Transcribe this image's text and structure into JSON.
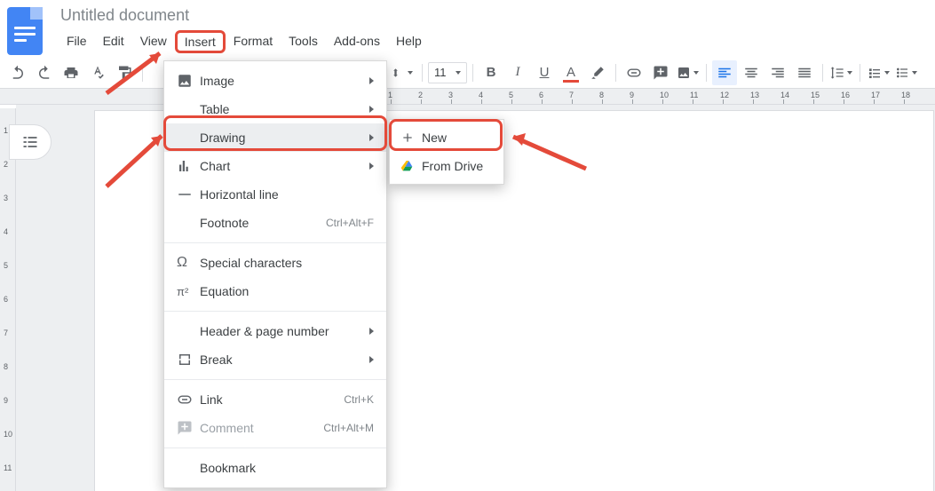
{
  "doc_title": "Untitled document",
  "menus": {
    "file": "File",
    "edit": "Edit",
    "view": "View",
    "insert": "Insert",
    "format": "Format",
    "tools": "Tools",
    "addons": "Add-ons",
    "help": "Help"
  },
  "toolbar": {
    "font_size": "11"
  },
  "ruler": {
    "ticks": [
      "1",
      "2",
      "3",
      "4",
      "5",
      "6",
      "7",
      "8",
      "9",
      "10",
      "11",
      "12",
      "13",
      "14",
      "15",
      "16",
      "17",
      "18"
    ]
  },
  "vruler": [
    "1",
    "2",
    "3",
    "4",
    "5",
    "6",
    "7",
    "8",
    "9",
    "10",
    "11"
  ],
  "insert_menu": {
    "image": "Image",
    "table": "Table",
    "drawing": "Drawing",
    "chart": "Chart",
    "hline": "Horizontal line",
    "footnote": "Footnote",
    "footnote_shortcut": "Ctrl+Alt+F",
    "special": "Special characters",
    "equation": "Equation",
    "header_page": "Header & page number",
    "break": "Break",
    "link": "Link",
    "link_shortcut": "Ctrl+K",
    "comment": "Comment",
    "comment_shortcut": "Ctrl+Alt+M",
    "bookmark": "Bookmark"
  },
  "drawing_submenu": {
    "new": "New",
    "from_drive": "From Drive"
  }
}
